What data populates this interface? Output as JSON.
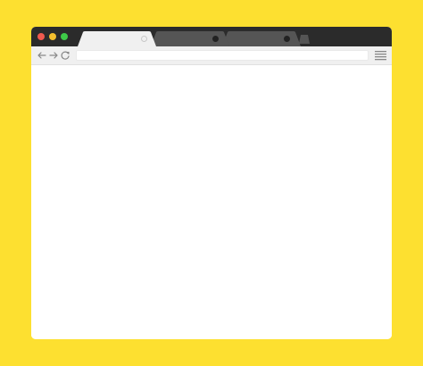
{
  "colors": {
    "backdrop": "#fde030",
    "titlebar": "#2b2b2b",
    "tab_active": "#f0f0f0",
    "tab_inactive": "#555555",
    "toolbar": "#f0f0f0",
    "close": "#f05a4f",
    "minimize": "#f5bf2e",
    "maximize": "#3ec948",
    "icon": "#888888"
  },
  "window_controls": {
    "close_icon": "close-circle",
    "minimize_icon": "minimize-circle",
    "maximize_icon": "maximize-circle"
  },
  "tabs": [
    {
      "label": "",
      "active": true,
      "close_icon": "close-icon"
    },
    {
      "label": "",
      "active": false,
      "close_icon": "close-icon"
    },
    {
      "label": "",
      "active": false,
      "close_icon": "close-icon"
    }
  ],
  "new_tab_icon": "new-tab-icon",
  "toolbar": {
    "back_icon": "arrow-left-icon",
    "forward_icon": "arrow-right-icon",
    "reload_icon": "reload-icon",
    "address": {
      "value": "",
      "placeholder": ""
    },
    "menu_icon": "hamburger-menu-icon"
  },
  "page": {
    "content": ""
  }
}
